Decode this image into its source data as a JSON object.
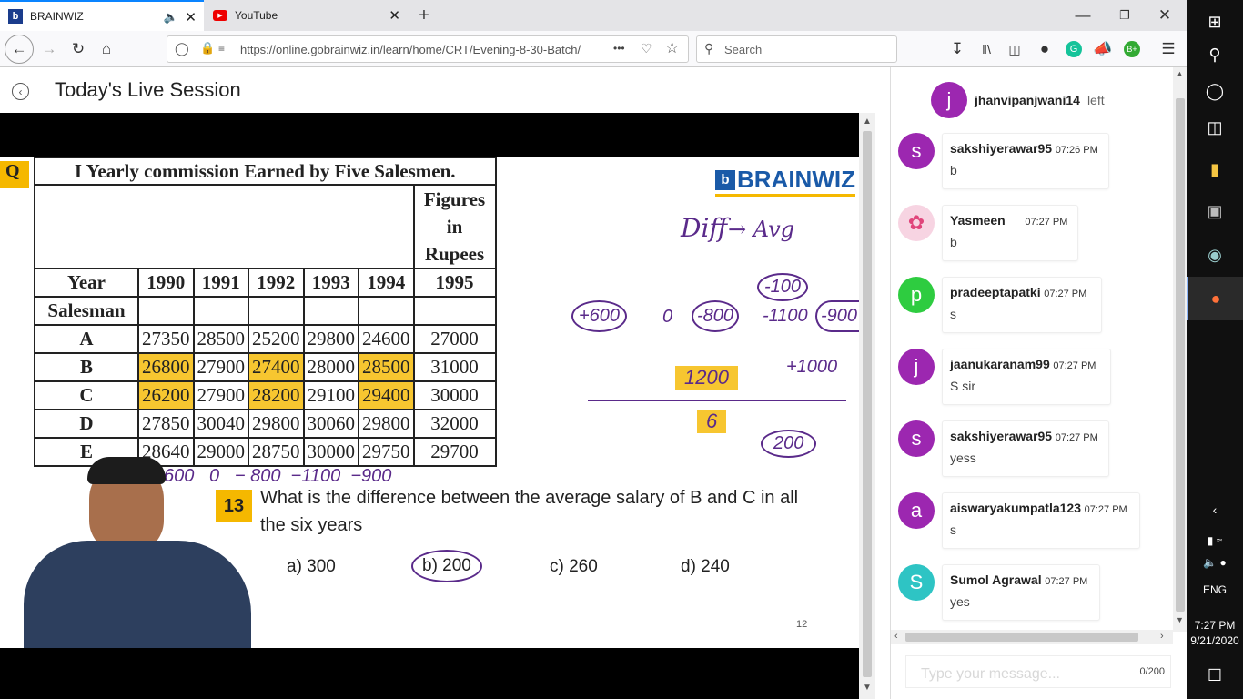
{
  "browser": {
    "tabs": [
      {
        "title": "BRAINWIZ",
        "active": true
      },
      {
        "title": "YouTube",
        "active": false
      }
    ],
    "url": "https://online.gobrainwiz.in/learn/home/CRT/Evening-8-30-Batch/",
    "search_placeholder": "Search",
    "ellipsis": "•••"
  },
  "page": {
    "title": "Today's Live Session"
  },
  "slide": {
    "q_marker": "Q",
    "table_title": "I Yearly commission Earned by Five Salesmen.",
    "figures_label": "Figures in Rupees",
    "brand": "BRAINWIZ",
    "year_header": "Year",
    "salesman_header": "Salesman",
    "years": [
      "1990",
      "1991",
      "1992",
      "1993",
      "1994",
      "1995"
    ],
    "rows": [
      {
        "name": "A",
        "values": [
          "27350",
          "28500",
          "25200",
          "29800",
          "24600",
          "27000"
        ]
      },
      {
        "name": "B",
        "values": [
          "26800",
          "27900",
          "27400",
          "28000",
          "28500",
          "31000"
        ]
      },
      {
        "name": "C",
        "values": [
          "26200",
          "27900",
          "28200",
          "29100",
          "29400",
          "30000"
        ]
      },
      {
        "name": "D",
        "values": [
          "27850",
          "30040",
          "29800",
          "30060",
          "29800",
          "32000"
        ]
      },
      {
        "name": "E",
        "values": [
          "28640",
          "29000",
          "28750",
          "30000",
          "29750",
          "29700"
        ]
      }
    ],
    "question_number": "13",
    "question_line1": "What is the difference between the average salary of B and C in all",
    "question_line2": "the six years",
    "options": [
      "a) 300",
      "b) 200",
      "c) 260",
      "d) 240"
    ],
    "page_number": "12",
    "handwriting": {
      "diff": "Diff",
      "arrow_avg": "→ Avg",
      "plus600": "+600",
      "zero": "0",
      "minus800": "-800",
      "minus1100": "-1100",
      "minus900": "-900",
      "minus100": "-100",
      "plus1000": "+1000",
      "twelve_hundred": "1200",
      "six": "6",
      "two_hundred": "200",
      "bottom_row": "600   0   − 800  −1100  −900"
    }
  },
  "chat": {
    "header_user": "jhanvipanjwani14",
    "header_status": "left",
    "header_avatar": "j",
    "header_avatar_color": "#9c27b0",
    "messages": [
      {
        "avatar": "s",
        "color": "#9c27b0",
        "user": "sakshiyerawar95",
        "time": "07:26 PM",
        "text": "b"
      },
      {
        "avatar": "",
        "color": "#f3c6d6",
        "user": "Yasmeen",
        "time": "07:27 PM",
        "text": "b"
      },
      {
        "avatar": "p",
        "color": "#2ecc40",
        "user": "pradeeptapatki",
        "time": "07:27 PM",
        "text": "s"
      },
      {
        "avatar": "j",
        "color": "#9c27b0",
        "user": "jaanukaranam99",
        "time": "07:27 PM",
        "text": "S sir"
      },
      {
        "avatar": "s",
        "color": "#9c27b0",
        "user": "sakshiyerawar95",
        "time": "07:27 PM",
        "text": "yess"
      },
      {
        "avatar": "a",
        "color": "#9c27b0",
        "user": "aiswaryakumpatla123",
        "time": "07:27 PM",
        "text": "s"
      },
      {
        "avatar": "S",
        "color": "#2ec4c4",
        "user": "Sumol Agrawal",
        "time": "07:27 PM",
        "text": "yes"
      }
    ],
    "input_placeholder": "Type your message...",
    "char_count": "0/200"
  },
  "taskbar": {
    "lang": "ENG",
    "time": "7:27 PM",
    "date": "9/21/2020"
  }
}
